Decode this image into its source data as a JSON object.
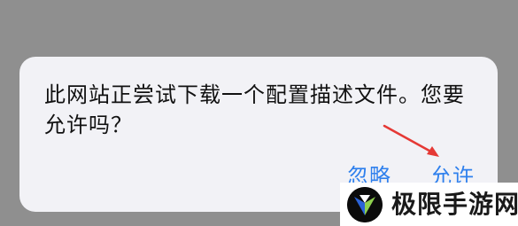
{
  "dialog": {
    "message": "此网站正尝试下载一个配置描述文件。您要允许吗？",
    "buttons": {
      "ignore": "忽略",
      "allow": "允许"
    }
  },
  "watermark": {
    "site_name": "极限手游网"
  },
  "colors": {
    "background": "#8f8f8f",
    "dialog_background": "#f2f2f6",
    "button_blue": "#2f80ed",
    "arrow_red": "#e53935"
  }
}
